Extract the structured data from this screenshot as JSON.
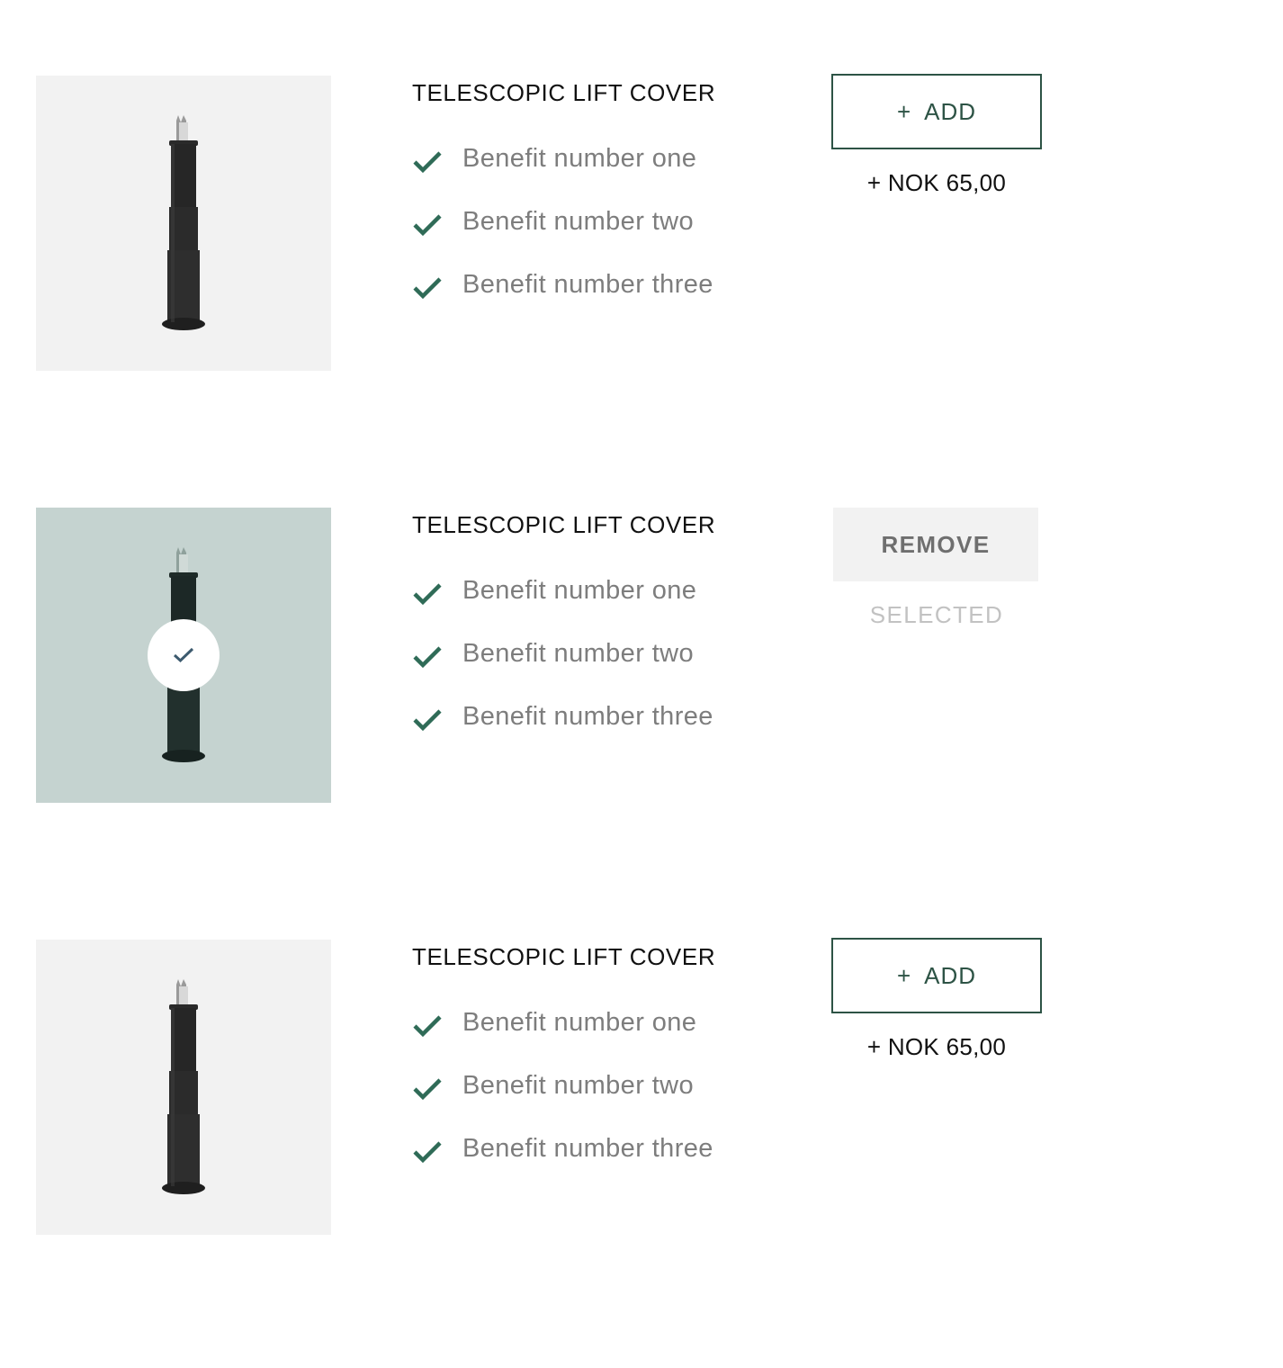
{
  "products": [
    {
      "title": "TELESCOPIC LIFT COVER",
      "benefits": [
        "Benefit number one",
        "Benefit number two",
        "Benefit number three"
      ],
      "state": "unselected",
      "add_icon": "+",
      "add_label": "ADD",
      "price": "+ NOK 65,00"
    },
    {
      "title": "TELESCOPIC LIFT COVER",
      "benefits": [
        "Benefit number one",
        "Benefit number two",
        "Benefit number three"
      ],
      "state": "selected",
      "remove_label": "REMOVE",
      "selected_label": "SELECTED"
    },
    {
      "title": "TELESCOPIC LIFT COVER",
      "benefits": [
        "Benefit number one",
        "Benefit number two",
        "Benefit number three"
      ],
      "state": "unselected",
      "add_icon": "+",
      "add_label": "ADD",
      "price": "+ NOK 65,00"
    }
  ],
  "colors": {
    "accent_green": "#2d5345",
    "check_green": "#2f6b57",
    "benefit_text": "#7d7d7d",
    "thumb_bg": "#f2f2f2",
    "thumb_selected_bg": "#c5d3d0",
    "remove_bg": "#f2f2f2"
  },
  "icons": {
    "benefit": "checkmark-icon",
    "selected": "check-circle-icon",
    "product": "telescopic-lift-cover-image"
  }
}
